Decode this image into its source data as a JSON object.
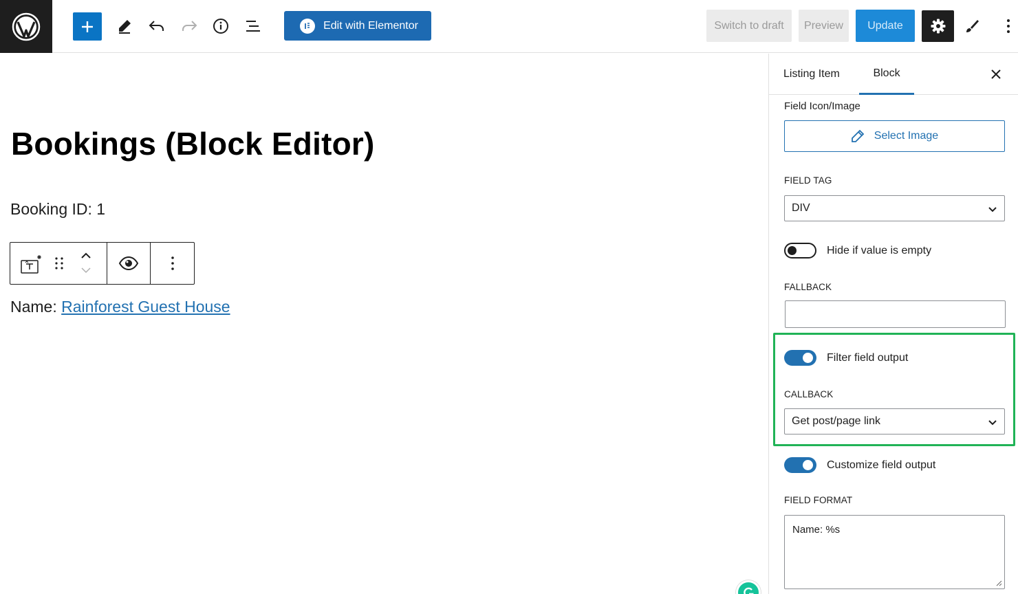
{
  "toolbar": {
    "edit_with_elementor": "Edit with Elementor",
    "switch_to_draft": "Switch to draft",
    "preview": "Preview",
    "update": "Update",
    "accent": "#0a74c4"
  },
  "icons": {
    "logo": "wordpress-logo-icon",
    "add": "plus-icon",
    "tools": "pencil-icon",
    "undo": "undo-icon",
    "redo": "redo-icon",
    "details": "info-icon",
    "outline": "list-view-icon",
    "settings": "gear-icon",
    "styles": "brush-icon",
    "more": "vertical-ellipsis-icon"
  },
  "canvas": {
    "title": "Bookings (Block Editor)",
    "booking_id": "Booking ID: 1",
    "name_prefix": "Name: ",
    "name_link": "Rainforest Guest House"
  },
  "sidebar": {
    "tabs": [
      "Listing Item",
      "Block"
    ],
    "active_tab": "Block",
    "field_icon_label": "Field Icon/Image",
    "select_image": "Select Image",
    "field_tag_label": "FIELD TAG",
    "field_tag_value": "DIV",
    "hide_if_empty_label": "Hide if value is empty",
    "hide_if_empty": false,
    "fallback_label": "FALLBACK",
    "fallback_value": "",
    "filter_output_label": "Filter field output",
    "filter_output": true,
    "callback_label": "CALLBACK",
    "callback_value": "Get post/page link",
    "customize_output_label": "Customize field output",
    "customize_output": true,
    "field_format_label": "FIELD FORMAT",
    "field_format_value": "Name: %s",
    "highlight_color": "#20b356"
  }
}
